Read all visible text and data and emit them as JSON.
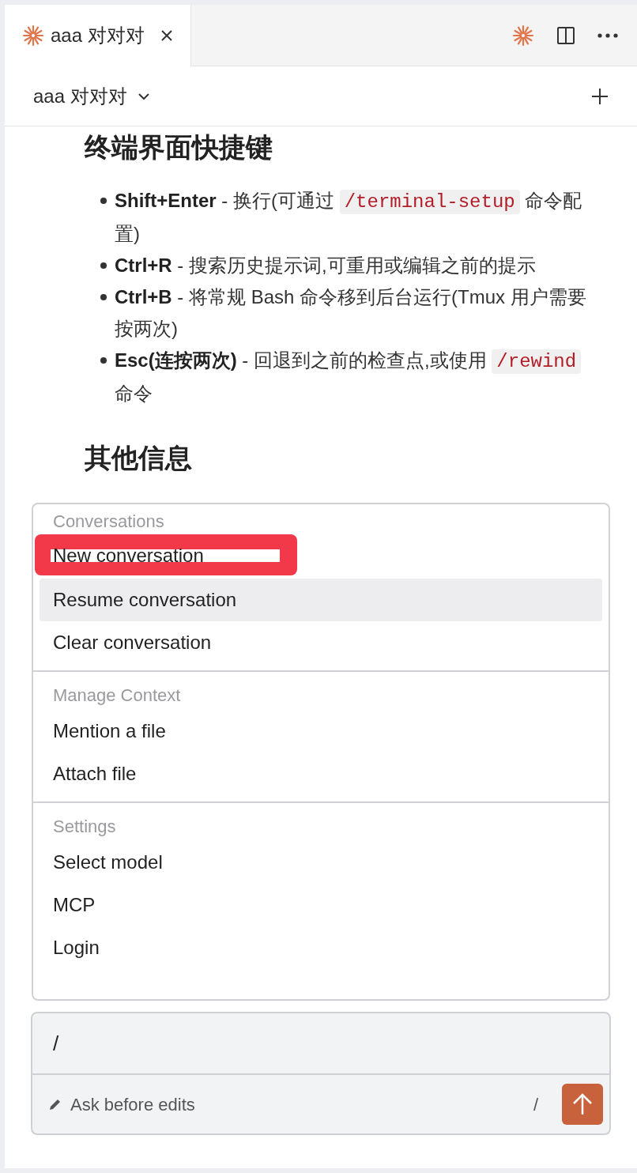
{
  "tabs": [
    {
      "label": "aaa 对对对",
      "selected": true
    }
  ],
  "header": {
    "title": "aaa 对对对"
  },
  "document": {
    "heading": "终端界面快捷键",
    "items": [
      [
        {
          "kind": "bold",
          "text": "Shift+Enter"
        },
        {
          "kind": "text",
          "text": " - 换行(可通过 "
        },
        {
          "kind": "code",
          "text": "/terminal-setup"
        },
        {
          "kind": "text",
          "text": " 命令配置)"
        }
      ],
      [
        {
          "kind": "bold",
          "text": "Ctrl+R"
        },
        {
          "kind": "text",
          "text": " - 搜索历史提示词,可重用或编辑之前的提示"
        }
      ],
      [
        {
          "kind": "bold",
          "text": "Ctrl+B"
        },
        {
          "kind": "text",
          "text": " - 将常规 Bash 命令移到后台运行(Tmux 用户需要按两次)"
        }
      ],
      [
        {
          "kind": "bold",
          "text": "Esc(连按两次)"
        },
        {
          "kind": "text",
          "text": " - 回退到之前的检查点,或使用 "
        },
        {
          "kind": "code",
          "text": "/rewind"
        },
        {
          "kind": "text",
          "text": " 命令"
        }
      ]
    ],
    "heading_2": "其他信息"
  },
  "menu": {
    "sections": [
      {
        "title": "Conversations",
        "items": [
          {
            "label": "New conversation",
            "selected": false,
            "highlighted": true
          },
          {
            "label": "Resume conversation",
            "selected": true,
            "highlighted": false
          },
          {
            "label": "Clear conversation",
            "selected": false,
            "highlighted": false
          }
        ]
      },
      {
        "title": "Manage Context",
        "items": [
          {
            "label": "Mention a file",
            "selected": false,
            "highlighted": false
          },
          {
            "label": "Attach file",
            "selected": false,
            "highlighted": false
          }
        ]
      },
      {
        "title": "Settings",
        "items": [
          {
            "label": "Select model",
            "selected": false,
            "highlighted": false
          },
          {
            "label": "MCP",
            "selected": false,
            "highlighted": false
          },
          {
            "label": "Login",
            "selected": false,
            "highlighted": false
          }
        ]
      }
    ]
  },
  "composer": {
    "value": "/",
    "mode": "Ask before edits",
    "shortcut_hint": "/"
  }
}
